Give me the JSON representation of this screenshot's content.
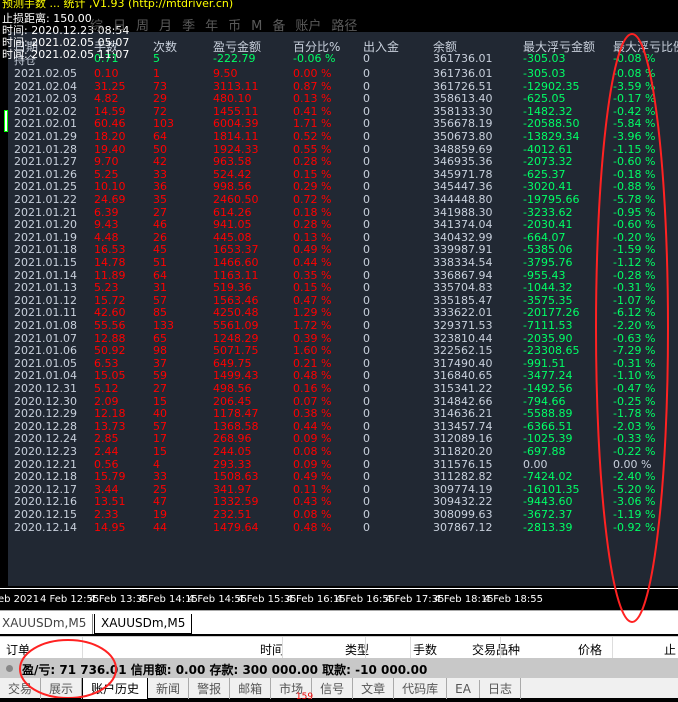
{
  "overlay": {
    "line1": "预测手数 ... 统计 ,V1.93 (http://mtdriver.cn)",
    "line2": "止损距离: 150.00",
    "line3": "时间: 2020.12.23 08:54",
    "line4": "时间: 2021.02.05 05:07",
    "line5": "时间: 2021.02.05 11:07"
  },
  "menu": [
    "综",
    "日",
    "周",
    "月",
    "季",
    "年",
    "币",
    "M",
    "备",
    "账户",
    "路径"
  ],
  "table": {
    "headers": [
      "日期",
      "手数",
      "次数",
      "盈亏金额",
      "百分比%",
      "出入金",
      "余额",
      "最大浮亏金额",
      "最大浮亏比例"
    ],
    "holding": [
      "持仓",
      "0.71",
      "5",
      "-222.79",
      "-0.06 %",
      "0",
      "361736.01",
      "-305.03",
      "-0.08 %"
    ],
    "rows": [
      [
        "2021.02.05",
        "0.10",
        "1",
        "9.50",
        "0.00 %",
        "0",
        "361736.01",
        "-305.03",
        "-0.08 %"
      ],
      [
        "2021.02.04",
        "31.25",
        "73",
        "3113.11",
        "0.87 %",
        "0",
        "361726.51",
        "-12902.35",
        "-3.59 %"
      ],
      [
        "2021.02.03",
        "4.82",
        "29",
        "480.10",
        "0.13 %",
        "0",
        "358613.40",
        "-625.05",
        "-0.17 %"
      ],
      [
        "2021.02.02",
        "14.59",
        "72",
        "1455.11",
        "0.41 %",
        "0",
        "358133.30",
        "-1482.32",
        "-0.42 %"
      ],
      [
        "2021.02.01",
        "60.46",
        "103",
        "6004.39",
        "1.71 %",
        "0",
        "356678.19",
        "-20588.50",
        "-5.84 %"
      ],
      [
        "2021.01.29",
        "18.20",
        "64",
        "1814.11",
        "0.52 %",
        "0",
        "350673.80",
        "-13829.34",
        "-3.96 %"
      ],
      [
        "2021.01.28",
        "19.40",
        "50",
        "1924.33",
        "0.55 %",
        "0",
        "348859.69",
        "-4012.61",
        "-1.15 %"
      ],
      [
        "2021.01.27",
        "9.70",
        "42",
        "963.58",
        "0.28 %",
        "0",
        "346935.36",
        "-2073.32",
        "-0.60 %"
      ],
      [
        "2021.01.26",
        "5.25",
        "33",
        "524.42",
        "0.15 %",
        "0",
        "345971.78",
        "-625.37",
        "-0.18 %"
      ],
      [
        "2021.01.25",
        "10.10",
        "36",
        "998.56",
        "0.29 %",
        "0",
        "345447.36",
        "-3020.41",
        "-0.88 %"
      ],
      [
        "2021.01.22",
        "24.69",
        "35",
        "2460.50",
        "0.72 %",
        "0",
        "344448.80",
        "-19795.66",
        "-5.78 %"
      ],
      [
        "2021.01.21",
        "6.39",
        "27",
        "614.26",
        "0.18 %",
        "0",
        "341988.30",
        "-3233.62",
        "-0.95 %"
      ],
      [
        "2021.01.20",
        "9.43",
        "46",
        "941.05",
        "0.28 %",
        "0",
        "341374.04",
        "-2030.41",
        "-0.60 %"
      ],
      [
        "2021.01.19",
        "4.48",
        "26",
        "445.08",
        "0.13 %",
        "0",
        "340432.99",
        "-664.07",
        "-0.20 %"
      ],
      [
        "2021.01.18",
        "16.53",
        "45",
        "1653.37",
        "0.49 %",
        "0",
        "339987.91",
        "-5385.06",
        "-1.59 %"
      ],
      [
        "2021.01.15",
        "14.78",
        "51",
        "1466.60",
        "0.44 %",
        "0",
        "338334.54",
        "-3795.76",
        "-1.12 %"
      ],
      [
        "2021.01.14",
        "11.89",
        "64",
        "1163.11",
        "0.35 %",
        "0",
        "336867.94",
        "-955.43",
        "-0.28 %"
      ],
      [
        "2021.01.13",
        "5.23",
        "31",
        "519.36",
        "0.15 %",
        "0",
        "335704.83",
        "-1044.32",
        "-0.31 %"
      ],
      [
        "2021.01.12",
        "15.72",
        "57",
        "1563.46",
        "0.47 %",
        "0",
        "335185.47",
        "-3575.35",
        "-1.07 %"
      ],
      [
        "2021.01.11",
        "42.60",
        "85",
        "4250.48",
        "1.29 %",
        "0",
        "333622.01",
        "-20177.26",
        "-6.12 %"
      ],
      [
        "2021.01.08",
        "55.56",
        "133",
        "5561.09",
        "1.72 %",
        "0",
        "329371.53",
        "-7111.53",
        "-2.20 %"
      ],
      [
        "2021.01.07",
        "12.88",
        "65",
        "1248.29",
        "0.39 %",
        "0",
        "323810.44",
        "-2035.90",
        "-0.63 %"
      ],
      [
        "2021.01.06",
        "50.92",
        "98",
        "5071.75",
        "1.60 %",
        "0",
        "322562.15",
        "-23308.65",
        "-7.29 %"
      ],
      [
        "2021.01.05",
        "6.53",
        "37",
        "649.75",
        "0.21 %",
        "0",
        "317490.40",
        "-991.51",
        "-0.31 %"
      ],
      [
        "2021.01.04",
        "15.05",
        "59",
        "1499.43",
        "0.48 %",
        "0",
        "316840.65",
        "-3477.24",
        "-1.10 %"
      ],
      [
        "2020.12.31",
        "5.12",
        "27",
        "498.56",
        "0.16 %",
        "0",
        "315341.22",
        "-1492.56",
        "-0.47 %"
      ],
      [
        "2020.12.30",
        "2.09",
        "15",
        "206.45",
        "0.07 %",
        "0",
        "314842.66",
        "-794.66",
        "-0.25 %"
      ],
      [
        "2020.12.29",
        "12.18",
        "40",
        "1178.47",
        "0.38 %",
        "0",
        "314636.21",
        "-5588.89",
        "-1.78 %"
      ],
      [
        "2020.12.28",
        "13.73",
        "57",
        "1368.58",
        "0.44 %",
        "0",
        "313457.74",
        "-6366.51",
        "-2.03 %"
      ],
      [
        "2020.12.24",
        "2.85",
        "17",
        "268.96",
        "0.09 %",
        "0",
        "312089.16",
        "-1025.39",
        "-0.33 %"
      ],
      [
        "2020.12.23",
        "2.44",
        "15",
        "244.05",
        "0.08 %",
        "0",
        "311820.20",
        "-697.88",
        "-0.22 %"
      ],
      [
        "2020.12.21",
        "0.56",
        "4",
        "293.33",
        "0.09 %",
        "0",
        "311576.15",
        "0.00",
        "0.00 %"
      ],
      [
        "2020.12.18",
        "15.79",
        "33",
        "1508.63",
        "0.49 %",
        "0",
        "311282.82",
        "-7424.02",
        "-2.40 %"
      ],
      [
        "2020.12.17",
        "3.44",
        "25",
        "341.97",
        "0.11 %",
        "0",
        "309774.19",
        "-16101.35",
        "-5.20 %"
      ],
      [
        "2020.12.16",
        "13.51",
        "47",
        "1332.59",
        "0.43 %",
        "0",
        "309432.22",
        "-9443.60",
        "-3.06 %"
      ],
      [
        "2020.12.15",
        "2.33",
        "19",
        "232.51",
        "0.08 %",
        "0",
        "308099.63",
        "-3672.37",
        "-1.19 %"
      ],
      [
        "2020.12.14",
        "14.95",
        "44",
        "1479.64",
        "0.48 %",
        "0",
        "307867.12",
        "-2813.39",
        "-0.92 %"
      ]
    ]
  },
  "time_axis": [
    "eb 2021",
    "4 Feb 12:55",
    "4 Feb 13:35",
    "4 Feb 14:15",
    "4 Feb 14:55",
    "4 Feb 15:35",
    "4 Feb 16:15",
    "4 Feb 16:55",
    "4 Feb 17:35",
    "4 Feb 18:15",
    "4 Feb 18:55"
  ],
  "chart_tabs": [
    "XAUUSDm,M5",
    "XAUUSDm,M5"
  ],
  "orders_header": [
    "订单",
    "时间",
    "类型",
    "手数",
    "交易品种",
    "价格",
    "止"
  ],
  "status": "盈/亏: 71 736.01  信用额: 0.00  存款: 300 000.00  取款: -10 000.00",
  "bottom_tabs": [
    "交易",
    "展示",
    "账户历史",
    "新闻",
    "警报",
    "邮箱",
    "市场",
    "信号",
    "文章",
    "代码库",
    "EA",
    "日志"
  ],
  "market_badge": "159",
  "colors": {
    "profit": "#ff0000",
    "drawdown": "#00ff66",
    "panel": "#212833",
    "annotation": "#ff2222"
  }
}
